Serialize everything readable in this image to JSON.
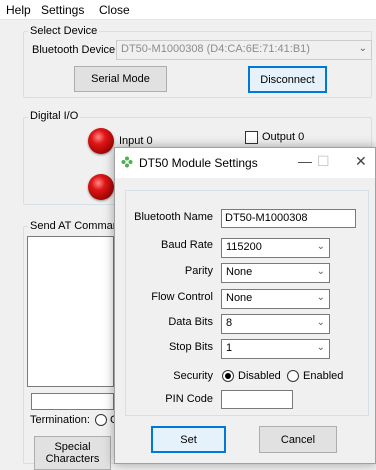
{
  "menu": {
    "items": [
      "Help",
      "Settings",
      "Close"
    ]
  },
  "select_device": {
    "group_label": "Select Device",
    "bluetooth_label": "Bluetooth Device",
    "bluetooth_value": "DT50-M1000308 (D4:CA:6E:71:41:B1)",
    "serial_mode_label": "Serial Mode",
    "disconnect_label": "Disconnect"
  },
  "digital_io": {
    "group_label": "Digital I/O",
    "input0_label": "Input 0",
    "output0_label": "Output 0"
  },
  "send_at": {
    "group_label": "Send AT Command",
    "termination_label": "Termination:",
    "termination_partial": "C",
    "special_label_1": "Special",
    "special_label_2": "Characters"
  },
  "dialog": {
    "title": "DT50 Module Settings",
    "minimize_glyph": "—",
    "maximize_glyph": "☐",
    "close_glyph": "✕",
    "bluetooth_name_label": "Bluetooth Name",
    "bluetooth_name_value": "DT50-M1000308",
    "baud_rate_label": "Baud Rate",
    "baud_rate_value": "115200",
    "parity_label": "Parity",
    "parity_value": "None",
    "flow_control_label": "Flow Control",
    "flow_control_value": "None",
    "data_bits_label": "Data Bits",
    "data_bits_value": "8",
    "stop_bits_label": "Stop Bits",
    "stop_bits_value": "1",
    "security_label": "Security",
    "security_disabled_label": "Disabled",
    "security_enabled_label": "Enabled",
    "security_selected": "Disabled",
    "pin_code_label": "PIN Code",
    "pin_code_value": "",
    "set_label": "Set",
    "cancel_label": "Cancel"
  },
  "icons": {
    "chevron": "chevron-down-icon",
    "dialog_icon": "gear-flower-icon"
  },
  "colors": {
    "accent": "#0078d7",
    "led_red": "#e01616",
    "dialog_icon_green": "#4caf50"
  }
}
